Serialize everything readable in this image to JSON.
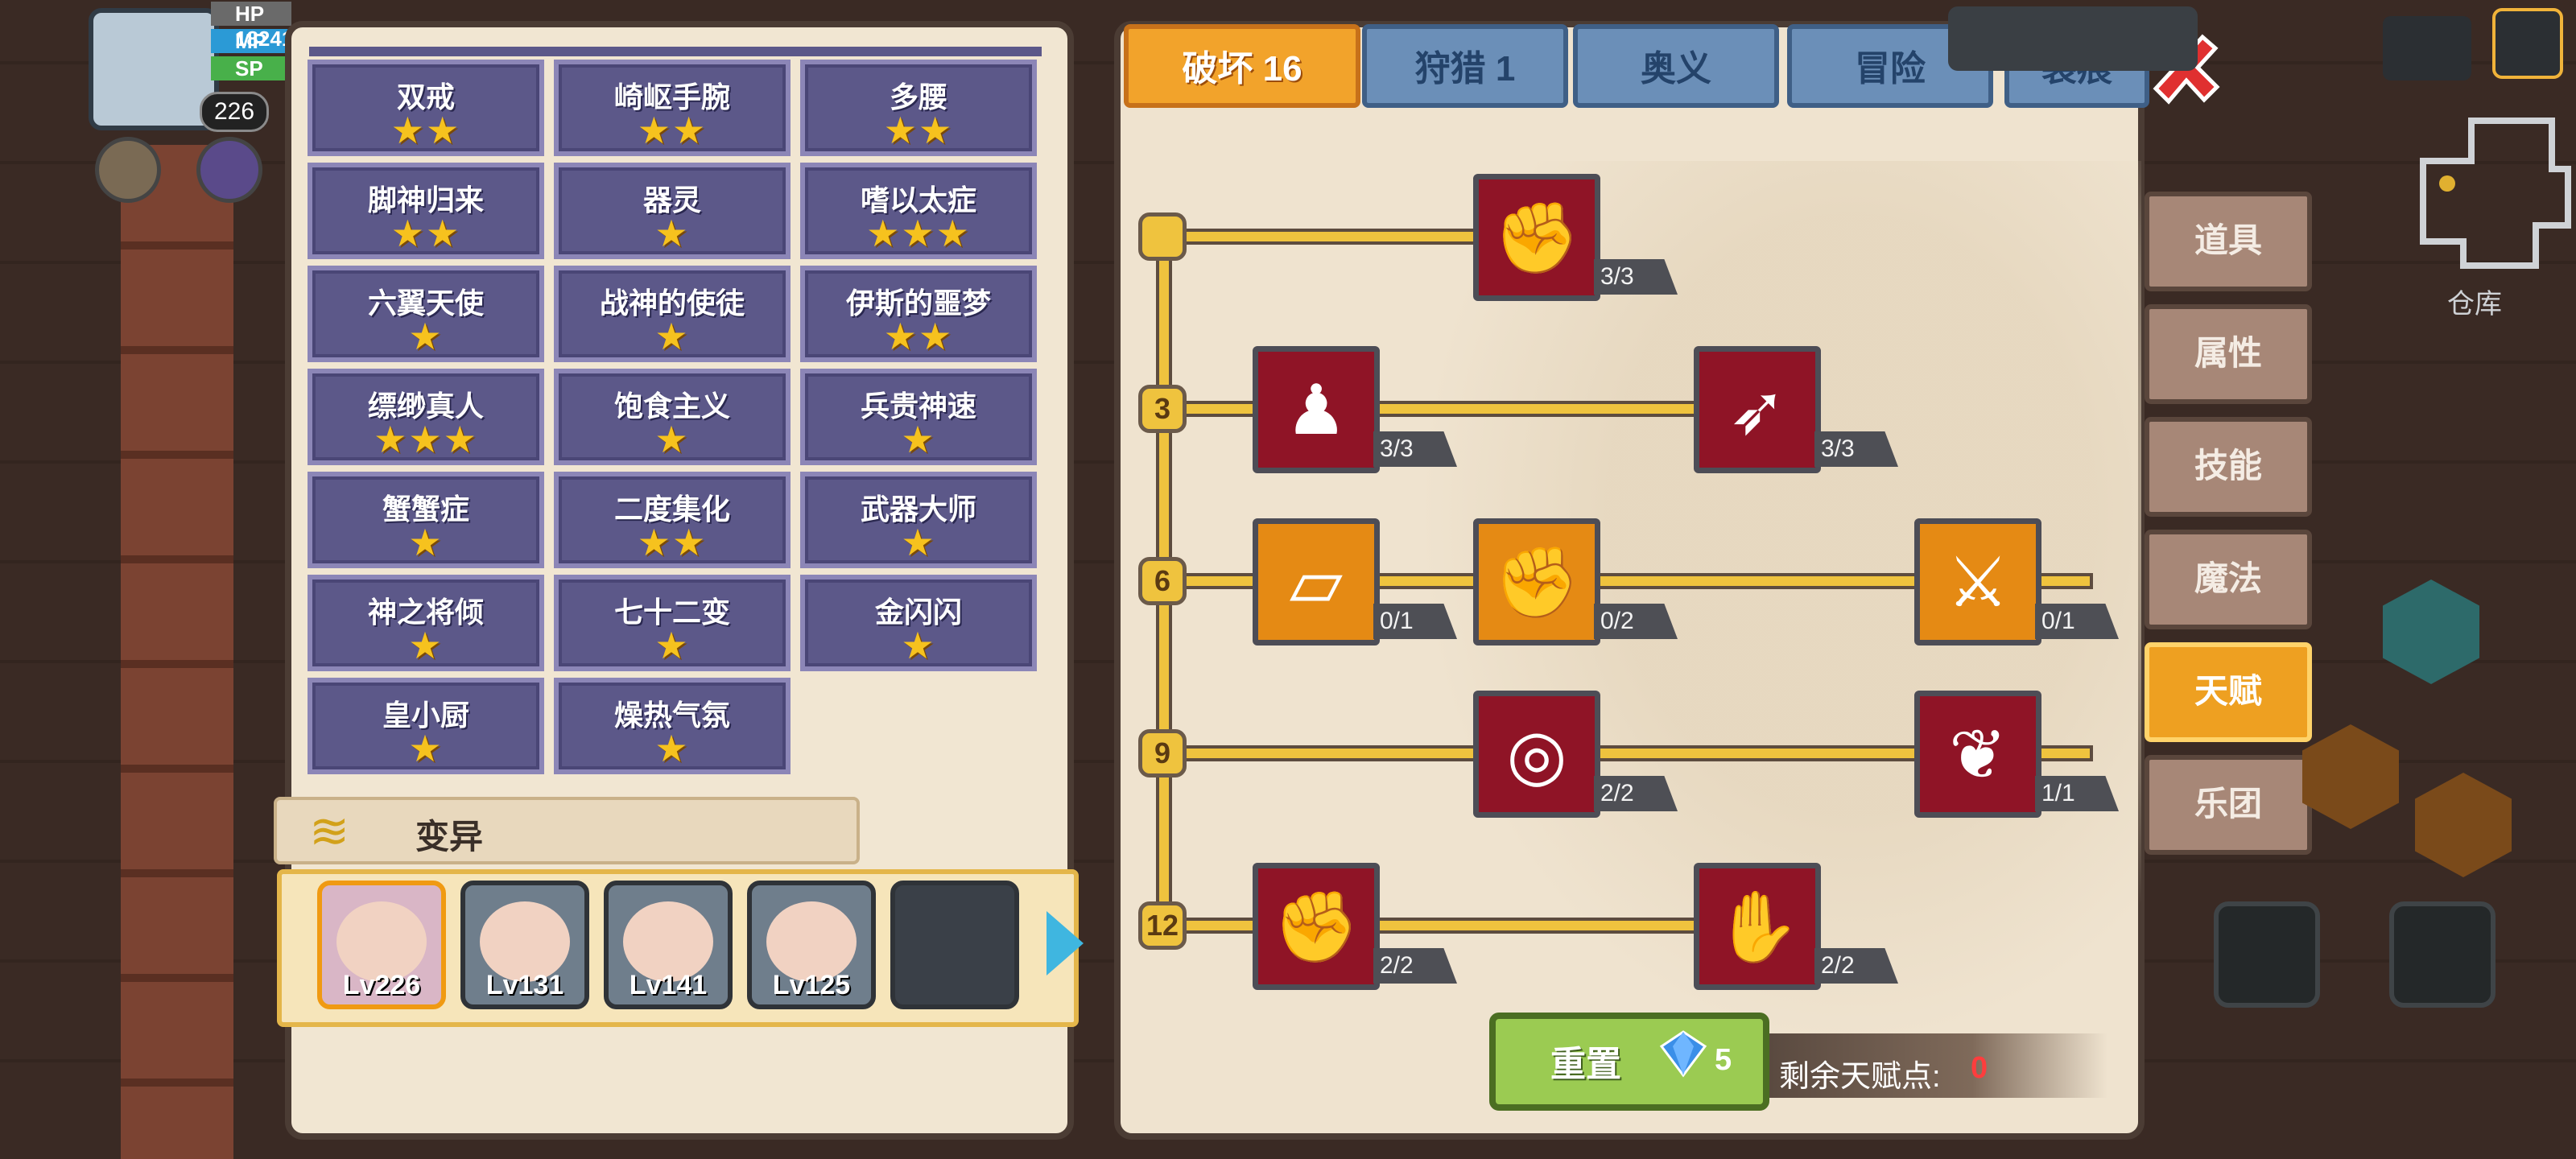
{
  "hud": {
    "level": "226",
    "bars": [
      {
        "label": "HP",
        "value": "182418"
      },
      {
        "label": "MP",
        "value": ""
      },
      {
        "label": "SP",
        "value": ""
      }
    ]
  },
  "traits": [
    {
      "name": "双戒",
      "stars": 2
    },
    {
      "name": "崎岖手腕",
      "stars": 2
    },
    {
      "name": "多腰",
      "stars": 2
    },
    {
      "name": "脚神归来",
      "stars": 2
    },
    {
      "name": "器灵",
      "stars": 1
    },
    {
      "name": "嗜以太症",
      "stars": 3
    },
    {
      "name": "六翼天使",
      "stars": 1
    },
    {
      "name": "战神的使徒",
      "stars": 1
    },
    {
      "name": "伊斯的噩梦",
      "stars": 2
    },
    {
      "name": "缥缈真人",
      "stars": 3
    },
    {
      "name": "饱食主义",
      "stars": 1
    },
    {
      "name": "兵贵神速",
      "stars": 1
    },
    {
      "name": "蟹蟹症",
      "stars": 1
    },
    {
      "name": "二度集化",
      "stars": 2
    },
    {
      "name": "武器大师",
      "stars": 1
    },
    {
      "name": "神之将倾",
      "stars": 1
    },
    {
      "name": "七十二变",
      "stars": 1
    },
    {
      "name": "金闪闪",
      "stars": 1
    },
    {
      "name": "皇小厨",
      "stars": 1
    },
    {
      "name": "燥热气氛",
      "stars": 1
    }
  ],
  "mutation": {
    "title": "变异"
  },
  "party": [
    {
      "lv": "Lv226",
      "selected": true
    },
    {
      "lv": "Lv131",
      "selected": false
    },
    {
      "lv": "Lv141",
      "selected": false
    },
    {
      "lv": "Lv125",
      "selected": false
    },
    {
      "lv": "",
      "selected": false
    }
  ],
  "tabs": [
    "破坏 16",
    "狩猎 1",
    "奥义",
    "冒险",
    "裂痕"
  ],
  "tiers": [
    "",
    "3",
    "6",
    "9",
    "12"
  ],
  "talents": [
    {
      "icon": "handshake",
      "count": "3/3",
      "style": "red"
    },
    {
      "icon": "torso",
      "count": "3/3",
      "style": "red"
    },
    {
      "icon": "arrow",
      "count": "3/3",
      "style": "red"
    },
    {
      "icon": "card",
      "count": "0/1",
      "style": "orange"
    },
    {
      "icon": "punch",
      "count": "0/2",
      "style": "orange"
    },
    {
      "icon": "sword-slash",
      "count": "0/1",
      "style": "orange"
    },
    {
      "icon": "ripple",
      "count": "2/2",
      "style": "red"
    },
    {
      "icon": "bat-wing",
      "count": "1/1",
      "style": "red"
    },
    {
      "icon": "fist",
      "count": "2/2",
      "style": "red"
    },
    {
      "icon": "fist-burst",
      "count": "2/2",
      "style": "red"
    }
  ],
  "reset": {
    "label": "重置",
    "cost": "5"
  },
  "remaining": {
    "label": "剩余天赋点:",
    "value": "0"
  },
  "side_menu": [
    "道具",
    "属性",
    "技能",
    "魔法",
    "天赋",
    "乐团"
  ],
  "side_menu_active": "天赋",
  "storage_label": "仓库",
  "colors": {
    "accent": "#f2a32b",
    "tab_inactive": "#6b8fb8",
    "cell": "#5c5889",
    "star": "#f6c21e",
    "remain_value": "#ff3d3d"
  }
}
